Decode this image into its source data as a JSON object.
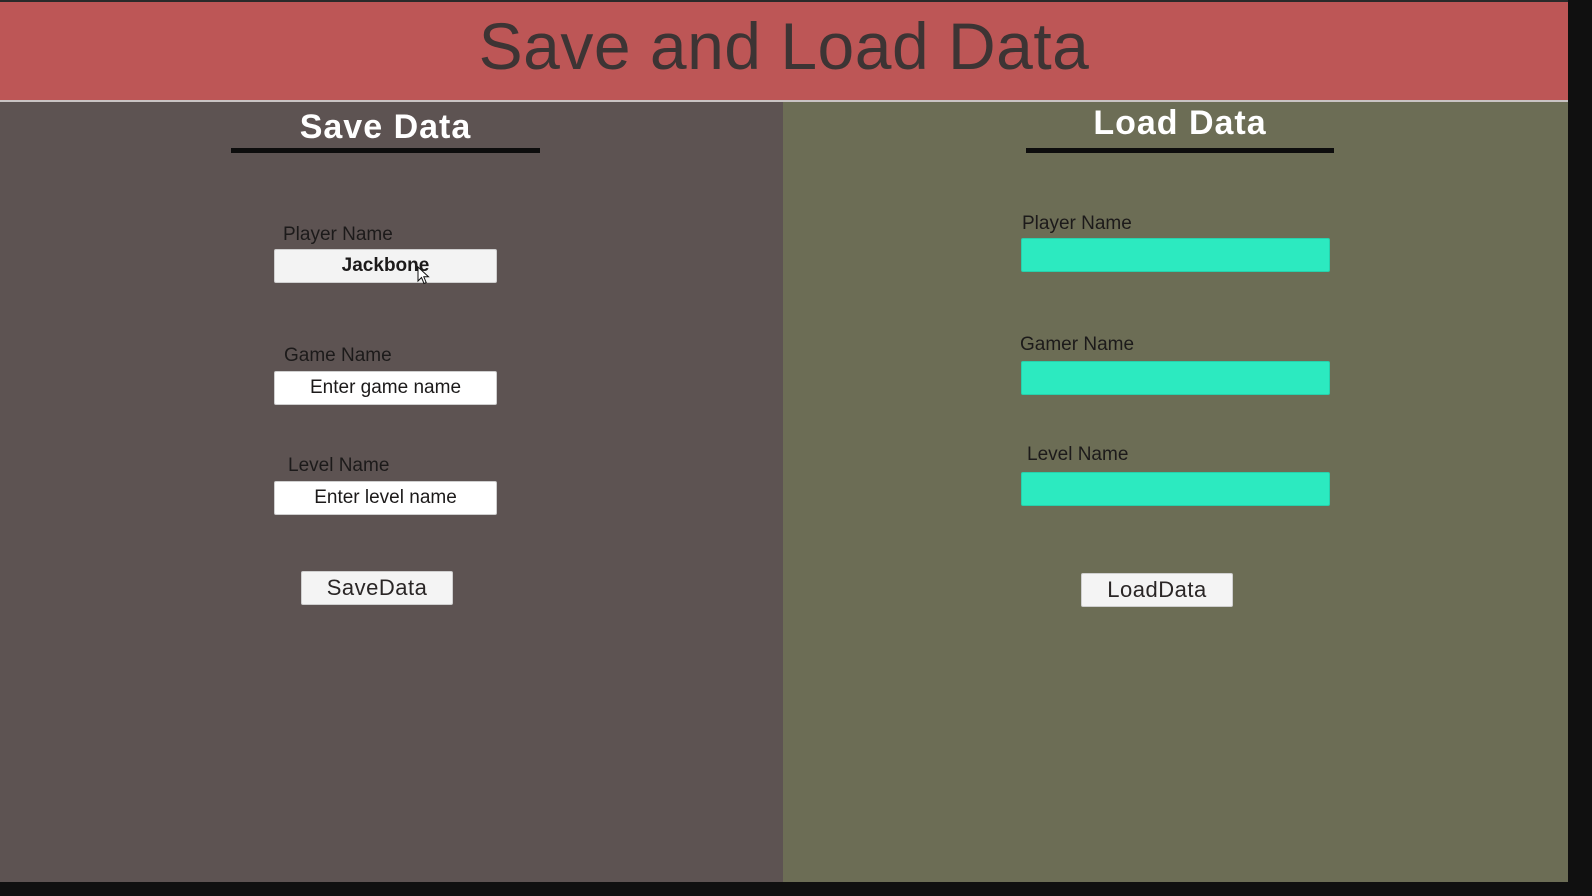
{
  "header": {
    "title": "Save and Load Data"
  },
  "save_panel": {
    "title": "Save Data",
    "fields": [
      {
        "label": "Player Name",
        "value": "Jackbone",
        "placeholder": ""
      },
      {
        "label": "Game Name",
        "value": "",
        "placeholder": "Enter game name"
      },
      {
        "label": "Level Name",
        "value": "",
        "placeholder": "Enter level name"
      }
    ],
    "button_label": "SaveData"
  },
  "load_panel": {
    "title": "Load Data",
    "fields": [
      {
        "label": "Player Name",
        "value": ""
      },
      {
        "label": "Gamer Name",
        "value": ""
      },
      {
        "label": "Level Name",
        "value": ""
      }
    ],
    "button_label": "LoadData"
  },
  "colors": {
    "header_bg": "#bd5656",
    "save_panel_bg": "#5d5352",
    "load_panel_bg": "#6c6d55",
    "load_field_bg": "#2ceac0"
  },
  "icons": {
    "cursor": "mouse-pointer-icon"
  }
}
